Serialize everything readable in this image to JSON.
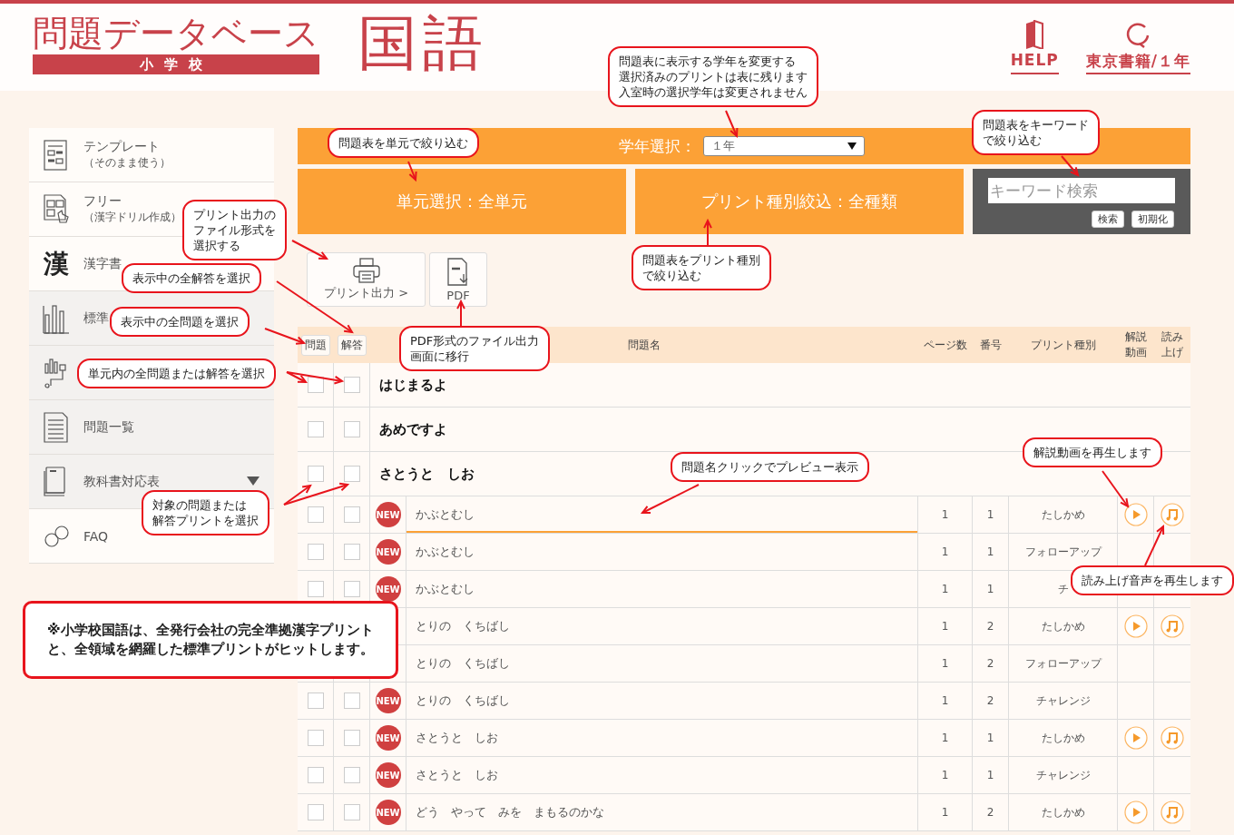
{
  "header": {
    "title": "問題データベース",
    "school": "小学校",
    "subject": "国語",
    "links": [
      {
        "kind": "bookmark",
        "label": "HELP"
      },
      {
        "kind": "refresh",
        "label": "東京書籍/１年"
      }
    ]
  },
  "sidebar": {
    "items": [
      {
        "kind": "template",
        "label": "テンプレート",
        "sub": "（そのまま使う）",
        "shaded": false
      },
      {
        "kind": "free",
        "label": "フリー",
        "sub": "（漢字ドリル作成）",
        "shaded": false
      },
      {
        "kind": "glyph",
        "glyph": "漢",
        "label": "漢字書",
        "shaded": false
      },
      {
        "kind": "bars",
        "label": "標準",
        "shaded": true
      },
      {
        "kind": "chart",
        "shaded": true
      },
      {
        "kind": "list",
        "label": "問題一覧",
        "shaded": true
      },
      {
        "kind": "book",
        "label": "教科書対応表",
        "shaded": true,
        "expanded": false
      },
      {
        "kind": "faq",
        "label": "FAQ",
        "shaded": false
      }
    ]
  },
  "filters": {
    "grade_label": "学年選択：",
    "grade_value": "１年",
    "unit_filter": "単元選択：全単元",
    "type_filter": "プリント種別絞込：全種類",
    "keyword_placeholder": "キーワード検索",
    "search_button": "検索",
    "reset_button": "初期化"
  },
  "actions": [
    {
      "kind": "printer",
      "label": "プリント出力 >"
    },
    {
      "kind": "pdf",
      "label": "PDF"
    }
  ],
  "table": {
    "select_buttons": [
      "問題",
      "解答"
    ],
    "columns": [
      "問題名",
      "ページ数",
      "番号",
      "プリント種別",
      "解説動画",
      "読み上げ"
    ],
    "rows": [
      {
        "kind": "unit",
        "title": "はじまるよ",
        "problem_checked": false,
        "answer_checked": false
      },
      {
        "kind": "unit",
        "title": "あめですよ",
        "problem_checked": false,
        "answer_checked": false
      },
      {
        "kind": "unit",
        "title": "さとうと　しお",
        "problem_checked": false,
        "answer_checked": false
      },
      {
        "kind": "item",
        "problem_checked": false,
        "answer_checked": false,
        "badge": "NEW",
        "title": "かぶとむし",
        "pages": "1",
        "number": "1",
        "type": "たしかめ",
        "video": true,
        "audio": true,
        "highlighted": true
      },
      {
        "kind": "item",
        "problem_checked": false,
        "answer_checked": false,
        "badge": "NEW",
        "title": "かぶとむし",
        "pages": "1",
        "number": "1",
        "type": "フォローアップ",
        "video": false,
        "audio": false,
        "highlighted": false
      },
      {
        "kind": "item",
        "problem_checked": false,
        "answer_checked": false,
        "badge": "NEW",
        "title": "かぶとむし",
        "pages": "1",
        "number": "1",
        "type": "チ",
        "video": false,
        "audio": false,
        "highlighted": false
      },
      {
        "kind": "item",
        "title": "とりの　くちばし",
        "pages": "1",
        "number": "2",
        "type": "たしかめ",
        "video": true,
        "audio": true,
        "highlighted": false
      },
      {
        "kind": "item",
        "title": "とりの　くちばし",
        "pages": "1",
        "number": "2",
        "type": "フォローアップ",
        "video": false,
        "audio": false,
        "highlighted": false
      },
      {
        "kind": "item",
        "problem_checked": false,
        "answer_checked": false,
        "badge": "NEW",
        "title": "とりの　くちばし",
        "pages": "1",
        "number": "2",
        "type": "チャレンジ",
        "video": false,
        "audio": false,
        "highlighted": false
      },
      {
        "kind": "item",
        "problem_checked": false,
        "answer_checked": false,
        "badge": "NEW",
        "title": "さとうと　しお",
        "pages": "1",
        "number": "1",
        "type": "たしかめ",
        "video": true,
        "audio": true,
        "highlighted": false
      },
      {
        "kind": "item",
        "problem_checked": false,
        "answer_checked": false,
        "badge": "NEW",
        "title": "さとうと　しお",
        "pages": "1",
        "number": "1",
        "type": "チャレンジ",
        "video": false,
        "audio": false,
        "highlighted": false
      },
      {
        "kind": "item",
        "problem_checked": false,
        "answer_checked": false,
        "badge": "NEW",
        "title": "どう　やって　みを　まもるのかな",
        "pages": "1",
        "number": "2",
        "type": "たしかめ",
        "video": true,
        "audio": true,
        "highlighted": false
      }
    ]
  },
  "callouts": [
    {
      "kind": "bubble",
      "lines": [
        "問題表に表示する学年を変更する",
        "選択済みのプリントは表に残ります",
        "入室時の選択学年は変更されません"
      ]
    },
    {
      "kind": "bubble",
      "lines": [
        "問題表を単元で絞り込む"
      ]
    },
    {
      "kind": "bubble",
      "lines": [
        "問題表をキーワード",
        "で絞り込む"
      ]
    },
    {
      "kind": "bubble",
      "lines": [
        "プリント出力の",
        "ファイル形式を",
        "選択する"
      ]
    },
    {
      "kind": "bubble",
      "lines": [
        "表示中の全解答を選択"
      ]
    },
    {
      "kind": "bubble",
      "lines": [
        "表示中の全問題を選択"
      ]
    },
    {
      "kind": "bubble",
      "lines": [
        "問題表をプリント種別",
        "で絞り込む"
      ]
    },
    {
      "kind": "bubble",
      "lines": [
        "PDF形式のファイル出力",
        "画面に移行"
      ]
    },
    {
      "kind": "bubble",
      "lines": [
        "単元内の全問題または解答を選択"
      ]
    },
    {
      "kind": "bubble",
      "lines": [
        "問題名クリックでプレビュー表示"
      ]
    },
    {
      "kind": "bubble",
      "lines": [
        "解説動画を再生します"
      ]
    },
    {
      "kind": "bubble",
      "lines": [
        "対象の問題または",
        "解答プリントを選択"
      ]
    },
    {
      "kind": "bubble",
      "lines": [
        "読み上げ音声を再生します"
      ]
    },
    {
      "kind": "note",
      "lines": [
        "※小学校国語は、全発行会社の完全準拠漢字プリント",
        "と、全領域を網羅した標準プリントがヒットします。"
      ]
    }
  ]
}
